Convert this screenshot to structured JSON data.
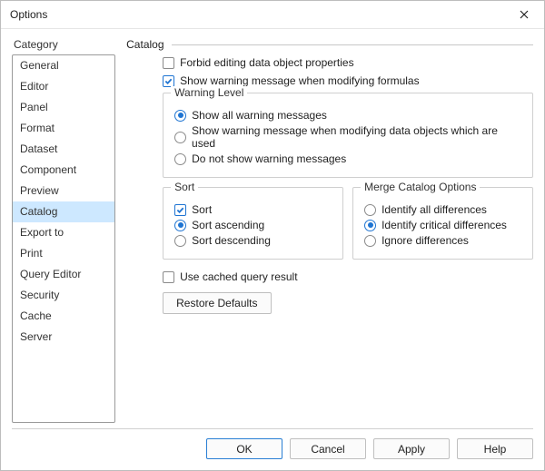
{
  "window": {
    "title": "Options"
  },
  "sidebar": {
    "heading": "Category",
    "items": [
      {
        "label": "General",
        "selected": false
      },
      {
        "label": "Editor",
        "selected": false
      },
      {
        "label": "Panel",
        "selected": false
      },
      {
        "label": "Format",
        "selected": false
      },
      {
        "label": "Dataset",
        "selected": false
      },
      {
        "label": "Component",
        "selected": false
      },
      {
        "label": "Preview",
        "selected": false
      },
      {
        "label": "Catalog",
        "selected": true
      },
      {
        "label": "Export to",
        "selected": false
      },
      {
        "label": "Print",
        "selected": false
      },
      {
        "label": "Query Editor",
        "selected": false
      },
      {
        "label": "Security",
        "selected": false
      },
      {
        "label": "Cache",
        "selected": false
      },
      {
        "label": "Server",
        "selected": false
      }
    ]
  },
  "panel": {
    "title": "Catalog",
    "forbid_editing": {
      "label": "Forbid editing data object properties",
      "checked": false
    },
    "show_warning": {
      "label": "Show warning message when modifying formulas",
      "checked": true
    },
    "warning_group": {
      "title": "Warning Level",
      "options": [
        {
          "label": "Show all warning messages",
          "checked": true
        },
        {
          "label": "Show warning message when modifying data objects which are used",
          "checked": false
        },
        {
          "label": "Do not show warning messages",
          "checked": false
        }
      ]
    },
    "sort_group": {
      "title": "Sort",
      "sort_chk": {
        "label": "Sort",
        "checked": true
      },
      "asc": {
        "label": "Sort ascending",
        "checked": true
      },
      "desc": {
        "label": "Sort descending",
        "checked": false
      }
    },
    "merge_group": {
      "title": "Merge Catalog Options",
      "options": [
        {
          "label": "Identify all differences",
          "checked": false
        },
        {
          "label": "Identify critical differences",
          "checked": true
        },
        {
          "label": "Ignore differences",
          "checked": false
        }
      ]
    },
    "use_cached": {
      "label": "Use cached query result",
      "checked": false
    },
    "restore": {
      "label": "Restore Defaults"
    }
  },
  "footer": {
    "ok": "OK",
    "cancel": "Cancel",
    "apply": "Apply",
    "help": "Help"
  }
}
